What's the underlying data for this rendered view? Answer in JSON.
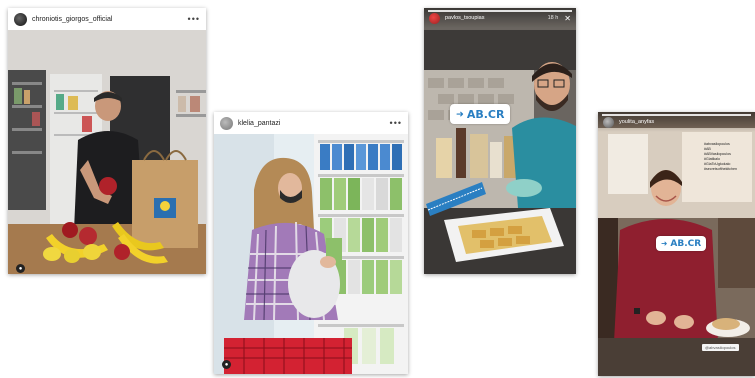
{
  "posts": [
    {
      "username": "chroniotis_giorgos_official",
      "more_icon": "ellipsis-icon"
    },
    {
      "username": "klelia_pantazi",
      "more_icon": "ellipsis-icon"
    }
  ],
  "stories": [
    {
      "username": "pavlos_tsoupias",
      "timestamp": "18 h",
      "badge": "AB.CR"
    },
    {
      "username": "youlita_anyfas",
      "badge": "AB.CR",
      "hashtags": [
        "#abvasilopoulos",
        "#AB",
        "#ABVasilopoulos",
        "#Giatikalo",
        "#GiaToUgkokalo",
        "#secretsofthekitchen"
      ],
      "tag_strip": "@abvasilopoulos"
    }
  ],
  "colors": {
    "ab_blue": "#2a7fc2",
    "header_bg": "#ffffff"
  }
}
